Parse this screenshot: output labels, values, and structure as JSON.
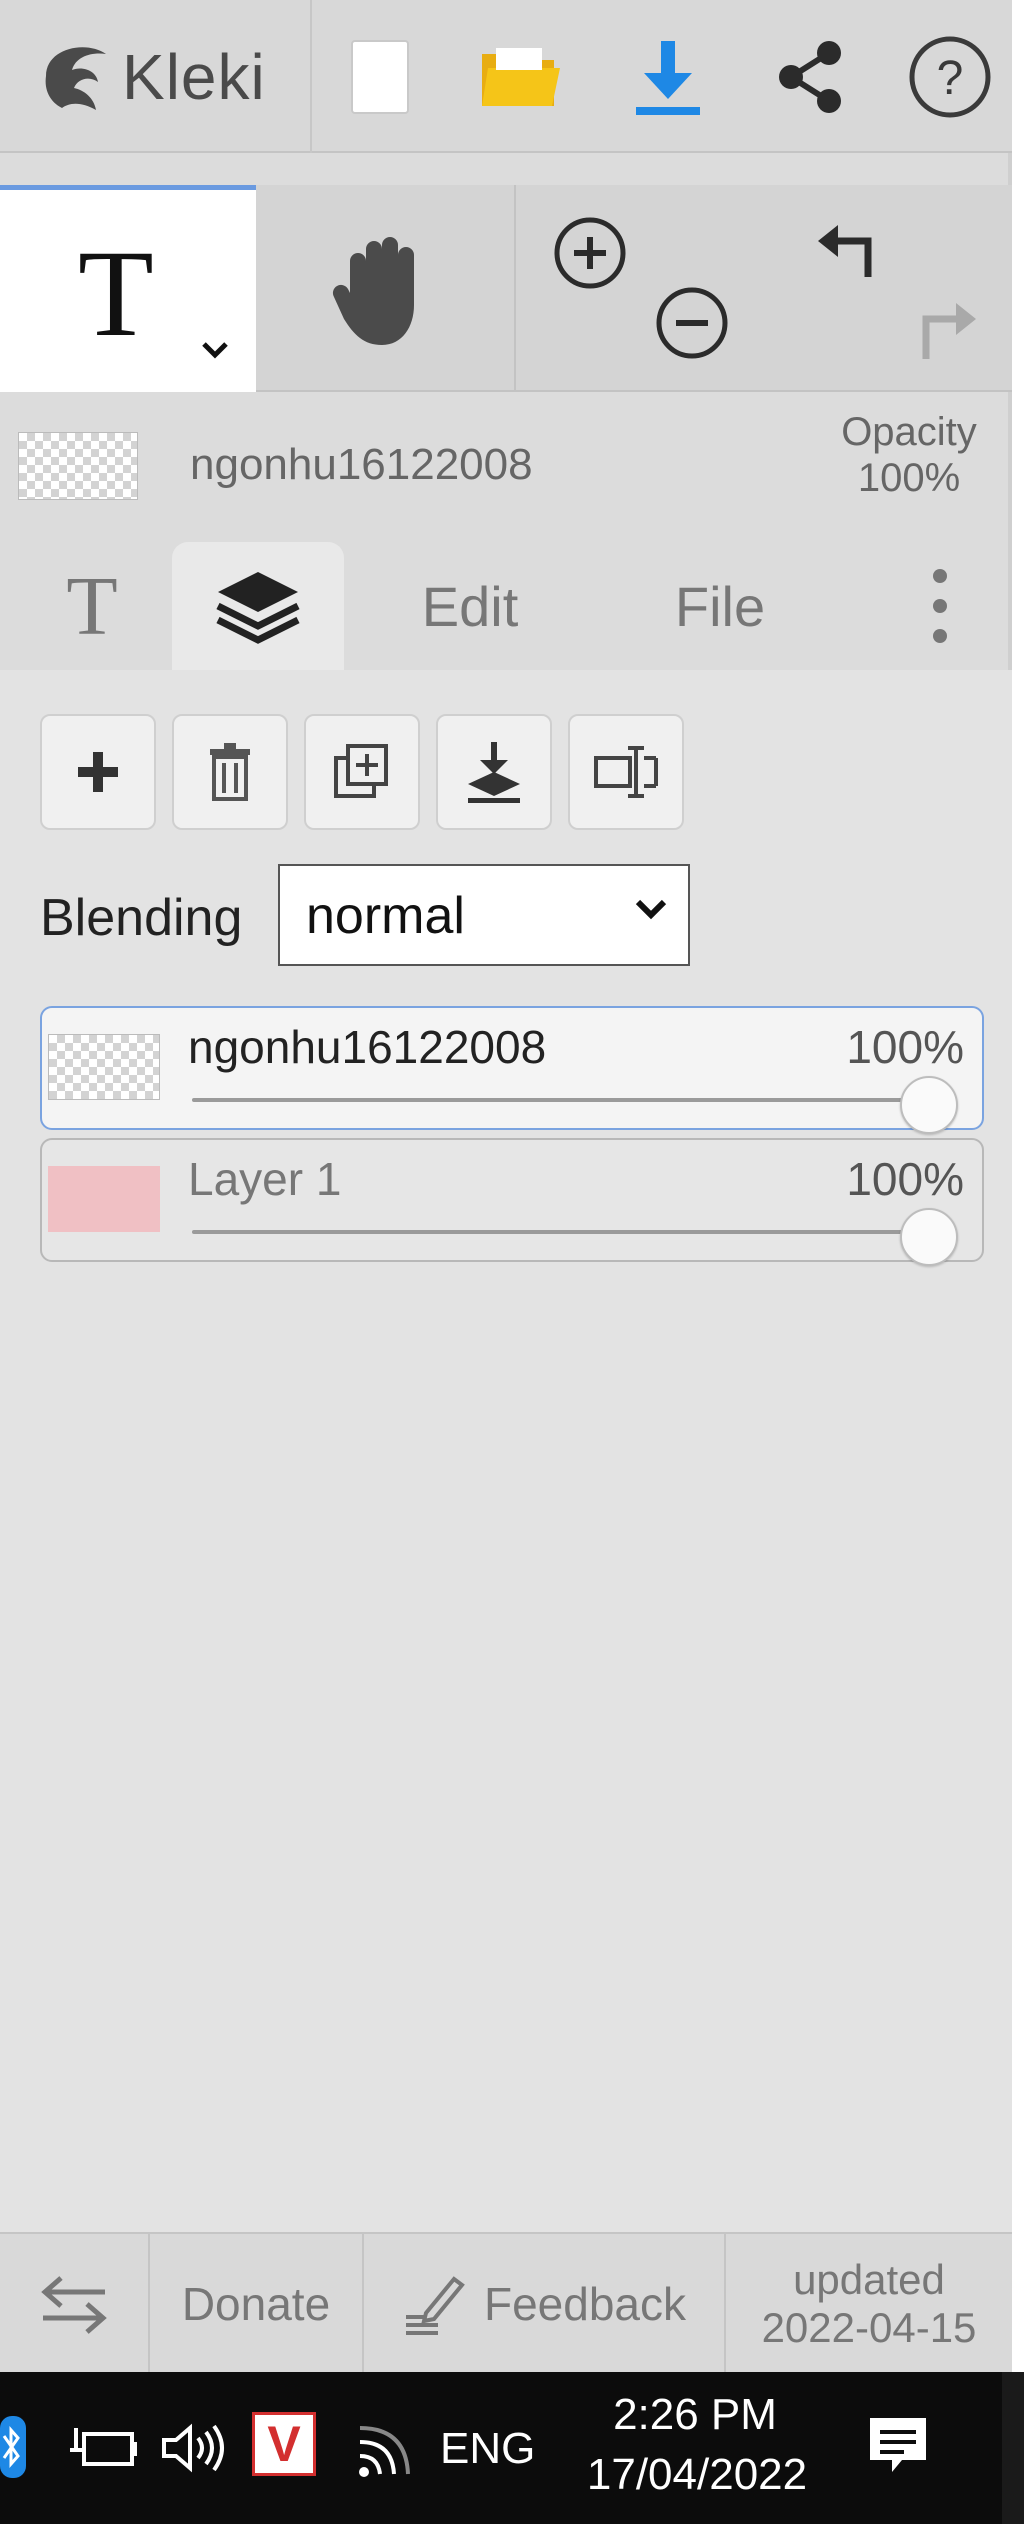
{
  "app": {
    "logo_text": "Kleki"
  },
  "header": {
    "icons": [
      "new-document-icon",
      "open-folder-icon",
      "download-icon",
      "share-icon",
      "help-icon"
    ],
    "help_glyph": "?"
  },
  "toolbar": {
    "active_tool_glyph": "T",
    "tools": [
      "text-tool",
      "hand-tool",
      "zoom-in",
      "zoom-out",
      "undo",
      "redo"
    ]
  },
  "layer_info": {
    "name": "ngonhu16122008",
    "opacity_label": "Opacity",
    "opacity_value": "100%"
  },
  "tabs": {
    "text_tab_glyph": "T",
    "edit": "Edit",
    "file": "File"
  },
  "layers_panel": {
    "blending_label": "Blending",
    "blending_value": "normal",
    "layers": [
      {
        "name": "ngonhu16122008",
        "opacity": "100%",
        "opacity_fraction": 1.0,
        "active": true
      },
      {
        "name": "Layer 1",
        "opacity": "100%",
        "opacity_fraction": 1.0,
        "active": false
      }
    ]
  },
  "footer": {
    "donate": "Donate",
    "feedback": "Feedback",
    "updated_label": "updated",
    "updated_date": "2022-04-15"
  },
  "taskbar": {
    "language": "ENG",
    "time": "2:26 PM",
    "date": "17/04/2022",
    "antivirus_glyph": "V"
  },
  "colors": {
    "accent_blue": "#1e88e5",
    "folder_yellow": "#f5c518",
    "antivirus_red": "#d32f2f",
    "layer1_fill": "#f0c0c4",
    "active_border": "#7aa3e0"
  }
}
